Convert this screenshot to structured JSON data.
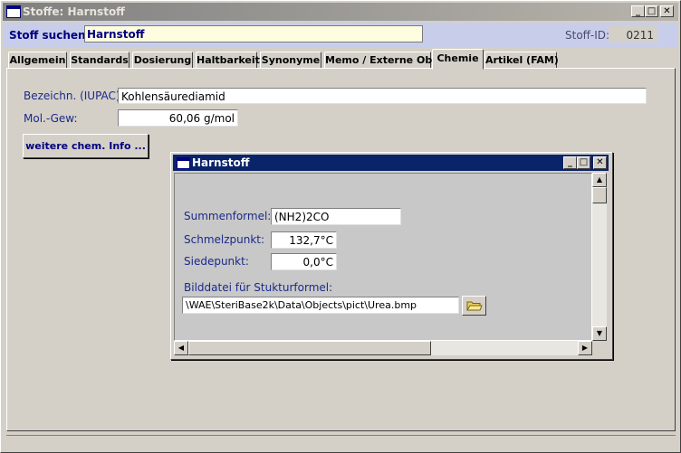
{
  "window": {
    "title": "Stoffe: Harnstoff",
    "controls": {
      "minimize": "_",
      "maximize": "□",
      "close": "✕"
    }
  },
  "search": {
    "label": "Stoff suchen:",
    "value": "Harnstoff",
    "id_label": "Stoff-ID:",
    "id_value": "0211"
  },
  "tabs": [
    {
      "label": "Allgemein"
    },
    {
      "label": "Standards"
    },
    {
      "label": "Dosierung"
    },
    {
      "label": "Haltbarkeit"
    },
    {
      "label": "Synonyme"
    },
    {
      "label": "Memo / Externe Obj."
    },
    {
      "label": "Chemie"
    },
    {
      "label": "Artikel (FAM)"
    }
  ],
  "active_tab": "Chemie",
  "chemie": {
    "iupac_label": "Bezeichn. (IUPAC):",
    "iupac_value": "Kohlensäurediamid",
    "molgew_label": "Mol.-Gew:",
    "molgew_value": "60,06 g/mol",
    "more_info_button": "weitere chem. Info ..."
  },
  "subwindow": {
    "title": "Harnstoff",
    "summenformel_label": "Summenformel:",
    "summenformel_value": "(NH2)2CO",
    "schmelzpunkt_label": "Schmelzpunkt:",
    "schmelzpunkt_value": "132,7°C",
    "siedepunkt_label": "Siedepunkt:",
    "siedepunkt_value": "0,0°C",
    "bilddatei_label": "Bilddatei für Stukturformel:",
    "bilddatei_value": "\\WAE\\SteriBase2k\\Data\\Objects\\pict\\Urea.bmp",
    "browse_icon": "folder-open-icon"
  },
  "colors": {
    "searchbar_bg": "#c8ceea",
    "label_blue": "#1a2a8a",
    "active_titlebar": "#0a246a"
  }
}
